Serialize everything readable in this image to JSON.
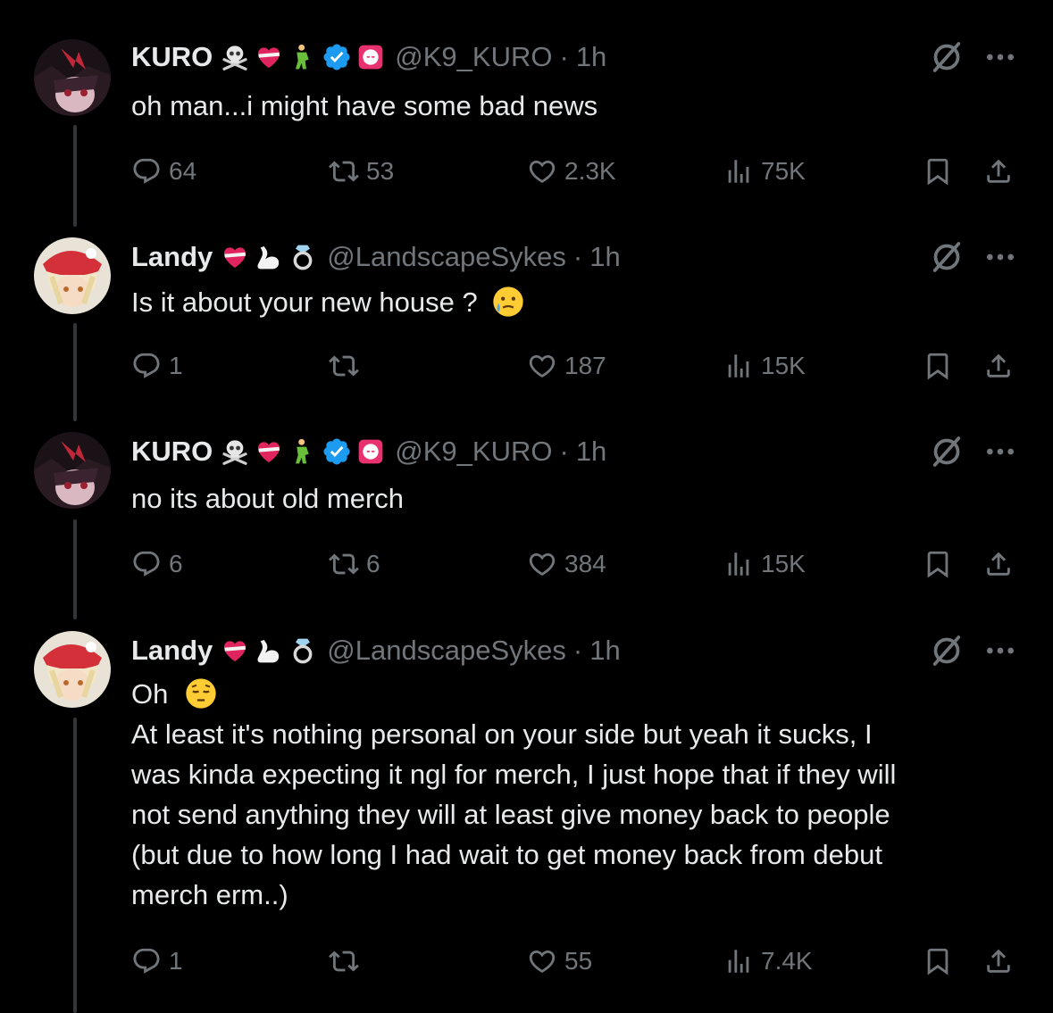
{
  "colors": {
    "background": "#000000",
    "text": "#e7e9ea",
    "muted": "#71767b",
    "verified": "#1d9bf0",
    "thread_line": "#333639"
  },
  "tweets": [
    {
      "author": "KURO",
      "handle": "@K9_KURO",
      "separator": "·",
      "time": "1h",
      "text": [
        "oh man...i might have some bad news"
      ],
      "replies": "64",
      "reposts": "53",
      "likes": "2.3K",
      "views": "75K"
    },
    {
      "author": "Landy",
      "handle": "@LandscapeSykes",
      "separator": "·",
      "time": "1h",
      "text": [
        "Is it about your new house ?"
      ],
      "replies": "1",
      "reposts": "",
      "likes": "187",
      "views": "15K"
    },
    {
      "author": "KURO",
      "handle": "@K9_KURO",
      "separator": "·",
      "time": "1h",
      "text": [
        "no its about old merch"
      ],
      "replies": "6",
      "reposts": "6",
      "likes": "384",
      "views": "15K"
    },
    {
      "author": "Landy",
      "handle": "@LandscapeSykes",
      "separator": "·",
      "time": "1h",
      "text": [
        "Oh",
        "At least it's nothing personal on your side but yeah it sucks, I",
        "was kinda expecting it ngl for merch, I just hope that if they will",
        "not send anything they will at least give money back to people",
        "(but due to how long I had wait to get money back from debut",
        "merch erm..)"
      ],
      "replies": "1",
      "reposts": "",
      "likes": "55",
      "views": "7.4K"
    }
  ],
  "icons": {
    "reply": "reply-icon",
    "repost": "repost-icon",
    "like": "heart-icon",
    "views": "views-icon",
    "bookmark": "bookmark-icon",
    "share": "share-icon",
    "grok": "grok-icon",
    "more": "more-icon",
    "verified": "verified-badge-icon"
  }
}
